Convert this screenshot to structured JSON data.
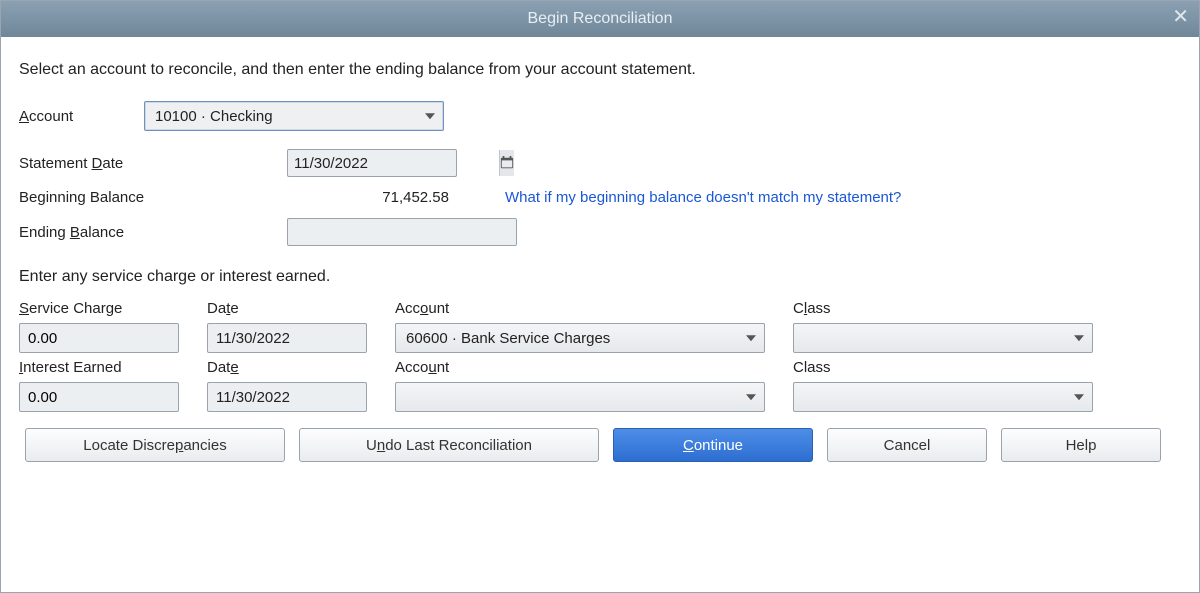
{
  "window": {
    "title": "Begin Reconciliation"
  },
  "instruction": "Select an account to reconcile, and then enter the ending balance from your account statement.",
  "account": {
    "label_pre": "A",
    "label_post": "ccount",
    "value": "10100 · Checking"
  },
  "statement_date": {
    "label_pre": "Statement ",
    "label_ul": "D",
    "label_post": "ate",
    "value": "11/30/2022"
  },
  "beginning_balance": {
    "label": "Beginning Balance",
    "value": "71,452.58"
  },
  "help_link": "What if my beginning balance doesn't match my statement?",
  "ending_balance": {
    "label_pre": "Ending ",
    "label_ul": "B",
    "label_post": "alance",
    "value": ""
  },
  "section_text": "Enter any service charge or interest earned.",
  "headers": {
    "service_charge_pre": "S",
    "service_charge_post": "ervice Charge",
    "date_pre": "Da",
    "date_ul": "t",
    "date_post": "e",
    "account_pre": "Acc",
    "account_ul": "o",
    "account_post": "unt",
    "class_pre": "C",
    "class_ul": "l",
    "class_post": "ass",
    "interest_pre": "I",
    "interest_post": "nterest Earned",
    "date2_pre": "Dat",
    "date2_ul": "e",
    "account2_pre": "Acco",
    "account2_ul": "u",
    "account2_post": "nt",
    "class2": "Class"
  },
  "service_charge": {
    "amount": "0.00",
    "date": "11/30/2022",
    "account": "60600 · Bank Service Charges",
    "class": ""
  },
  "interest_earned": {
    "amount": "0.00",
    "date": "11/30/2022",
    "account": "",
    "class": ""
  },
  "buttons": {
    "locate_pre": "Locate Discre",
    "locate_ul": "p",
    "locate_post": "ancies",
    "undo_pre": "U",
    "undo_ul": "n",
    "undo_post": "do Last Reconciliation",
    "continue_ul": "C",
    "continue_post": "ontinue",
    "cancel": "Cancel",
    "help": "Help"
  }
}
